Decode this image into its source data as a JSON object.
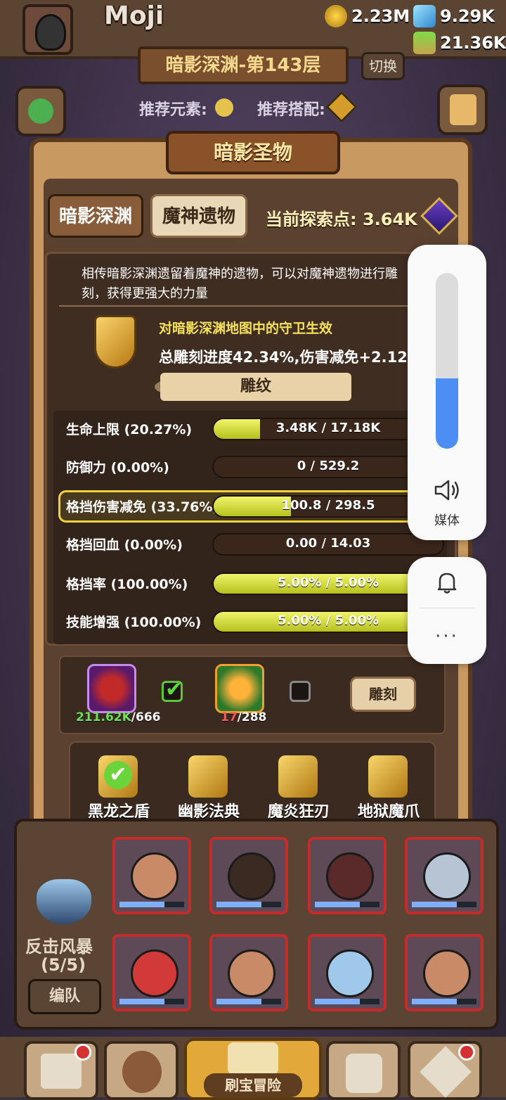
{
  "player": {
    "name": "Moji"
  },
  "resources": {
    "gold": "2.23M",
    "gems": "9.29K",
    "potion": "21.36K"
  },
  "floor": {
    "title": "暗影深渊-第143层",
    "switch_label": "切换"
  },
  "recommend": {
    "element_label": "推荐元素:",
    "combo_label": "推荐搭配:"
  },
  "dialog": {
    "title": "暗影圣物",
    "tabs": [
      {
        "label": "暗影深渊",
        "active": true
      },
      {
        "label": "魔神遗物",
        "active": false
      }
    ],
    "explore_label": "当前探索点:",
    "explore_value": "3.64K",
    "description": "相传暗影深渊遗留着魔神的遗物，可以对魔神遗物进行雕刻，获得更强大的力量",
    "effect_text": "对暗影深渊地图中的守卫生效",
    "total_text": "总雕刻进度42.34%,伤害减免+2.12%",
    "carve_section_title": "雕纹",
    "stats": [
      {
        "label": "生命上限 (20.27%)",
        "value": "3.48K / 17.18K",
        "progress": 0.2027,
        "highlight": false
      },
      {
        "label": "防御力 (0.00%)",
        "value": "0 / 529.2",
        "progress": 0.0,
        "highlight": false
      },
      {
        "label": "格挡伤害减免 (33.76%)",
        "value": "100.8 / 298.5",
        "progress": 0.3376,
        "highlight": true
      },
      {
        "label": "格挡回血 (0.00%)",
        "value": "0.00 / 14.03",
        "progress": 0.0,
        "highlight": false
      },
      {
        "label": "格挡率 (100.00%)",
        "value": "5.00% / 5.00%",
        "progress": 1.0,
        "highlight": false
      },
      {
        "label": "技能增强 (100.00%)",
        "value": "5.00% / 5.00%",
        "progress": 1.0,
        "highlight": false
      }
    ],
    "materials": [
      {
        "owned": "211.62K",
        "need": "/666",
        "checked": true
      },
      {
        "owned": "17",
        "need": "/288",
        "checked": false
      }
    ],
    "carve_button": "雕刻",
    "relics": [
      {
        "name": "黑龙之盾",
        "selected": true
      },
      {
        "name": "幽影法典",
        "selected": false
      },
      {
        "name": "魔炎狂刃",
        "selected": false
      },
      {
        "name": "地狱魔爪",
        "selected": false
      }
    ]
  },
  "team": {
    "name": "反击风暴",
    "count": "(5/5)",
    "formation_button": "编队"
  },
  "nav": {
    "main_label": "刷宝冒险"
  },
  "system_overlay": {
    "volume_label": "媒体",
    "more": "···",
    "volume_level": 0.4
  },
  "colors": {
    "accent_yellow": "#f0f46a",
    "volume_blue": "#4d8ef5",
    "frame_brown": "#5b3a1d"
  }
}
